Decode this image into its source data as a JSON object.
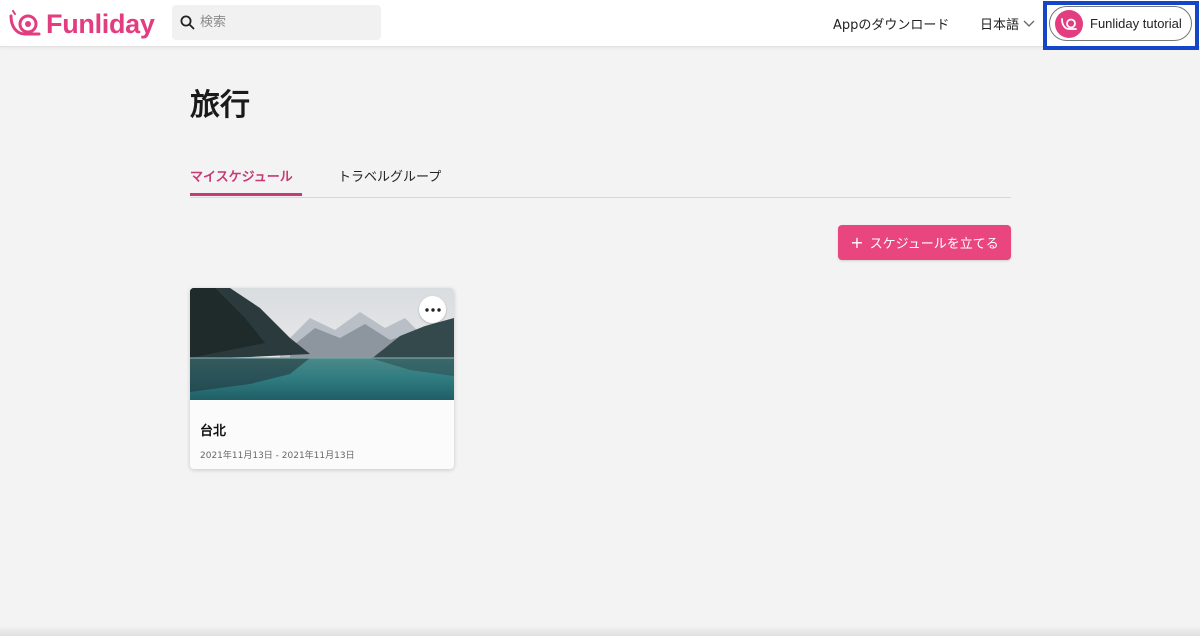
{
  "header": {
    "brand": "Funliday",
    "search_placeholder": "検索",
    "download_label": "Appのダウンロード",
    "language_label": "日本語",
    "user_name": "Funliday tutorial"
  },
  "main": {
    "title": "旅行",
    "tabs": [
      {
        "label": "マイスケジュール",
        "active": true
      },
      {
        "label": "トラベルグループ",
        "active": false
      }
    ],
    "create_button_label": "スケジュールを立てる",
    "trips": [
      {
        "title": "台北",
        "dates": "2021年11月13日 - 2021年11月13日"
      }
    ]
  },
  "colors": {
    "brand": "#e23d80",
    "active_tab": "#c73a73",
    "create_button": "#e9467f",
    "highlight_frame": "#1546c8"
  },
  "icons": {
    "logo": "snail-logo-icon",
    "search": "search-icon",
    "language_dropdown": "chevron-down-icon",
    "avatar": "snail-avatar-icon",
    "create": "plus-icon",
    "card_menu": "more-horizontal-icon"
  }
}
